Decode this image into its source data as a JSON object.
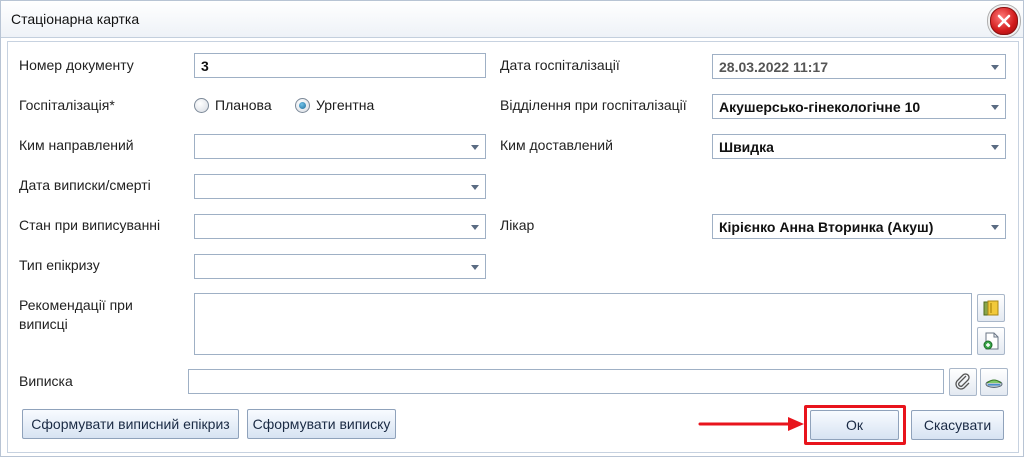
{
  "window": {
    "title": "Стаціонарна картка"
  },
  "fields": {
    "doc_number": {
      "label": "Номер документу",
      "value": "3"
    },
    "hosp_date": {
      "label": "Дата госпіталізації",
      "value": "28.03.2022 11:17"
    },
    "hospitalization": {
      "label": "Госпіталізація*",
      "options": [
        "Планова",
        "Ургентна"
      ],
      "selected": "Ургентна"
    },
    "department": {
      "label": "Відділення при госпіталізації",
      "value": "Акушерсько-гінекологічне 10"
    },
    "referred_by": {
      "label": "Ким направлений",
      "value": ""
    },
    "delivered_by": {
      "label": "Ким доставлений",
      "value": "Швидка"
    },
    "discharge_date": {
      "label": "Дата виписки/смерті",
      "value": ""
    },
    "discharge_state": {
      "label": "Стан при виписуванні",
      "value": ""
    },
    "doctor": {
      "label": "Лікар",
      "value": "Кірієнко Анна Вторинка (Акуш)"
    },
    "epicrisis_type": {
      "label": "Тип епікризу",
      "value": ""
    },
    "recommendations": {
      "label": "Рекомендації при виписці",
      "value": ""
    },
    "extract": {
      "label": "Виписка",
      "value": ""
    }
  },
  "buttons": {
    "form_epicrisis": "Сформувати виписний епікриз",
    "form_extract": "Сформувати виписку",
    "ok": "Ок",
    "cancel": "Скасувати"
  },
  "icons": {
    "close": "close-icon",
    "folder": "folder-icon",
    "add_document": "add-document-icon",
    "attach": "paperclip-icon",
    "scan": "scanner-icon"
  },
  "colors": {
    "annotation_red": "#e8141c",
    "border": "#9fb0c5",
    "button_text": "#1a2a44"
  }
}
